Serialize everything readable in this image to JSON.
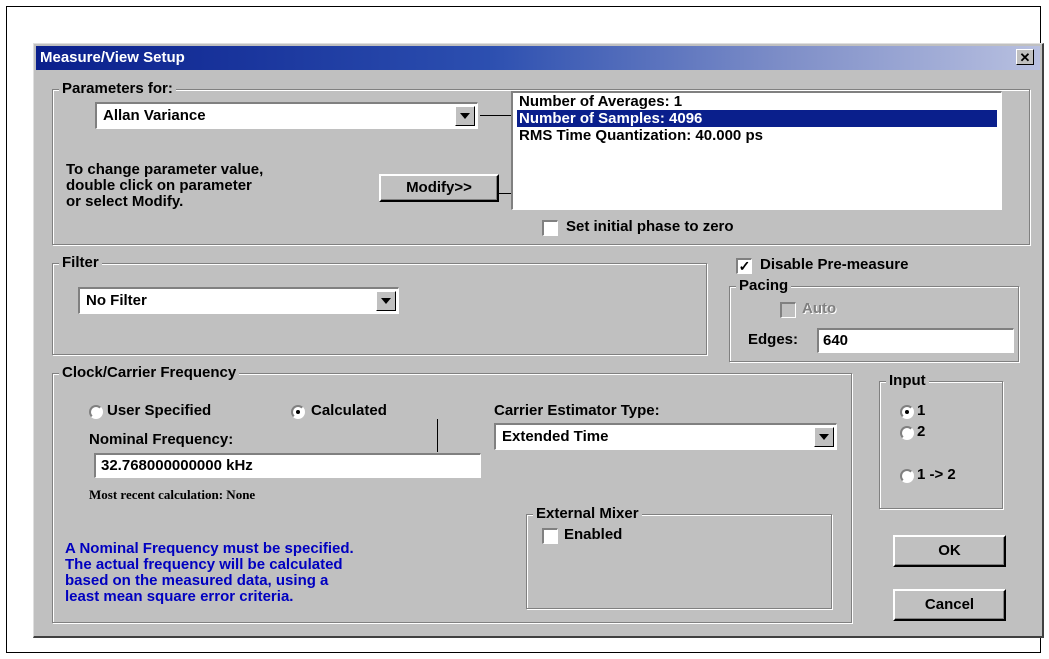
{
  "window": {
    "title": "Measure/View Setup",
    "close_label": "✕"
  },
  "parameters": {
    "legend": "Parameters for:",
    "selected": "Allan Variance",
    "help_lines": [
      "To change parameter value,",
      "double click on parameter",
      "or select Modify."
    ],
    "modify_label": "Modify>>",
    "list_items": [
      {
        "label": "Number of Averages:  1",
        "selected": false
      },
      {
        "label": "Number of Samples:  4096",
        "selected": true
      },
      {
        "label": "RMS Time Quantization: 40.000 ps",
        "selected": false
      }
    ],
    "phase_zero_label": "Set initial phase to zero",
    "phase_zero_checked": false
  },
  "filter": {
    "legend": "Filter",
    "selected": "No Filter"
  },
  "premeasure": {
    "label": "Disable Pre-measure",
    "checked": true,
    "check_glyph": "✓"
  },
  "pacing": {
    "legend": "Pacing",
    "auto_label": "Auto",
    "edges_label": "Edges:",
    "edges_value": "640"
  },
  "clock": {
    "legend": "Clock/Carrier Frequency",
    "user_specified_label": "User Specified",
    "calculated_label": "Calculated",
    "selected_mode": "Calculated",
    "nominal_label": "Nominal Frequency:",
    "nominal_value": "32.768000000000 kHz",
    "recent_calc": "Most recent calculation: None",
    "estimator_label": "Carrier Estimator Type:",
    "estimator_value": "Extended Time",
    "note_lines": [
      "A Nominal Frequency must be specified.",
      "The actual frequency will be calculated",
      "based on the measured data, using a",
      "least mean square error criteria."
    ]
  },
  "mixer": {
    "legend": "External Mixer",
    "enabled_label": "Enabled",
    "enabled": false
  },
  "input": {
    "legend": "Input",
    "options": [
      "1",
      "2",
      "1 -> 2"
    ],
    "selected": "1"
  },
  "buttons": {
    "ok": "OK",
    "cancel": "Cancel"
  }
}
